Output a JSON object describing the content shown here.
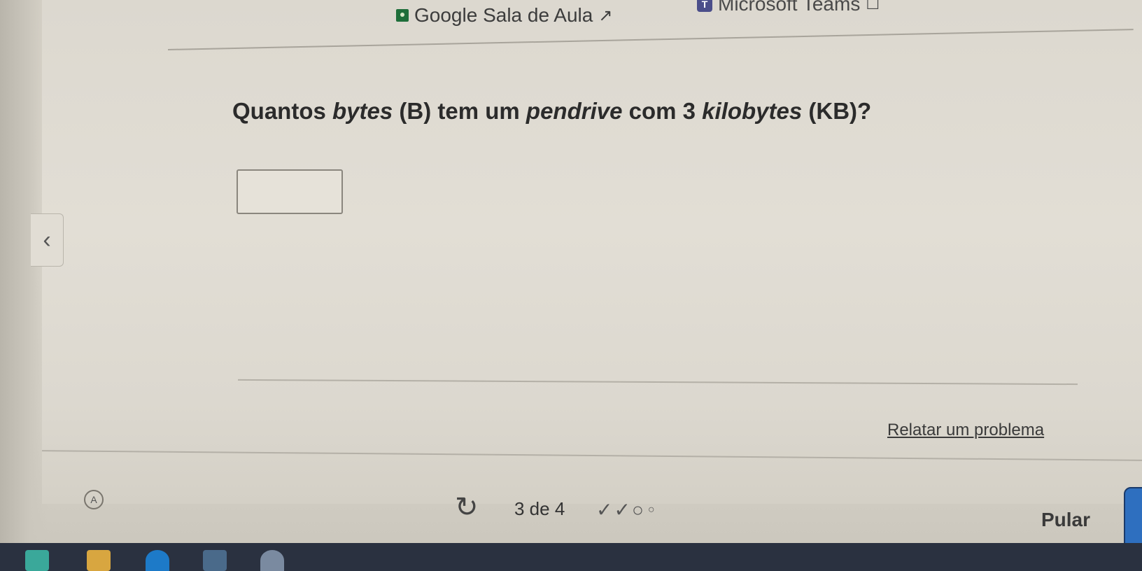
{
  "top_links": {
    "google_classroom": "Google Sala de Aula",
    "microsoft_teams": "Microsoft Teams"
  },
  "question": {
    "part1": "Quantos ",
    "bytes_word": "bytes",
    "part2": " (B) tem um ",
    "pendrive_word": "pendrive",
    "part3": " com 3 ",
    "kilobytes_word": "kilobytes",
    "part4": " (KB)?"
  },
  "answer": {
    "value": ""
  },
  "report_link": "Relatar um problema",
  "progress": {
    "text": "3 de 4",
    "current": 3,
    "total": 4
  },
  "skip_button": "Pular",
  "colors": {
    "next_button": "#2e6fbf",
    "taskbar": "#2a3140"
  }
}
